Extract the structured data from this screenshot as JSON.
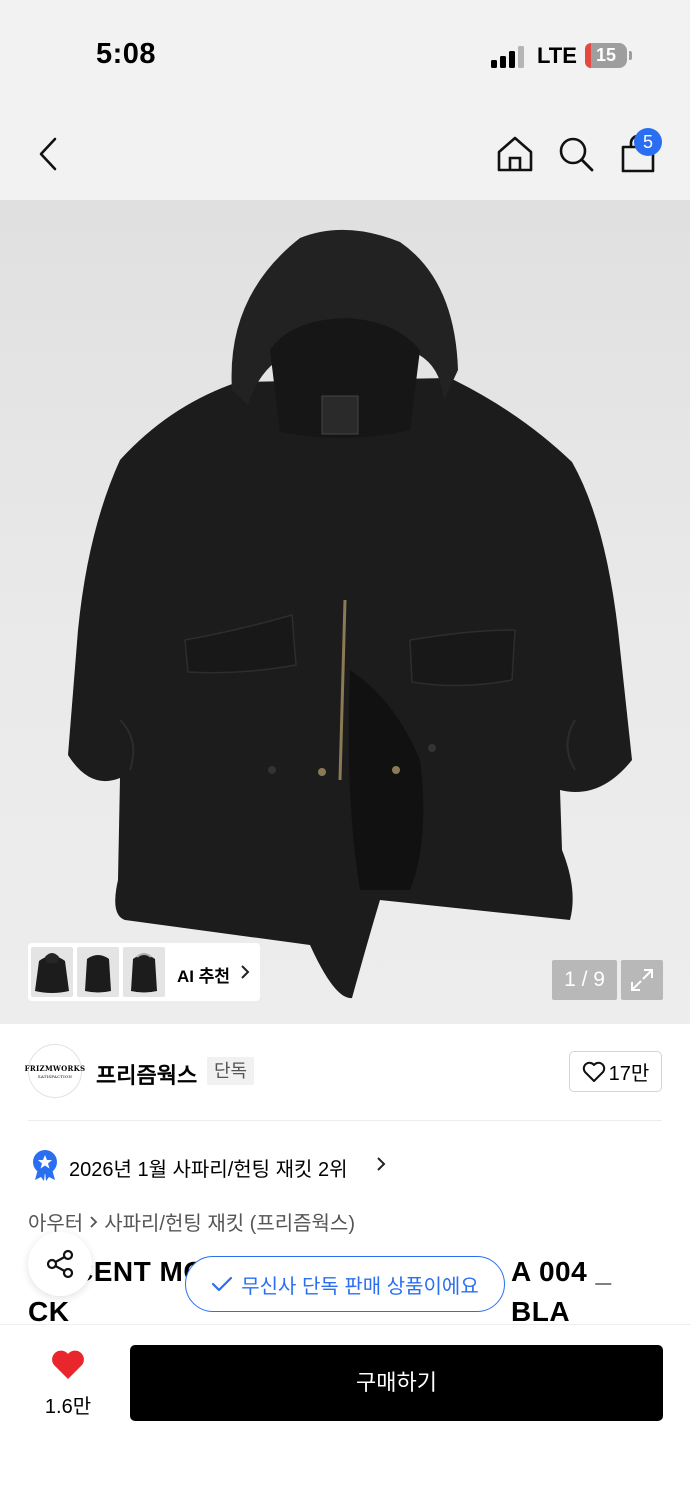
{
  "status_bar": {
    "time": "5:08",
    "network": "LTE",
    "battery": "15",
    "battery_level": 0.15
  },
  "nav": {
    "icons": [
      "back-icon",
      "home-icon",
      "search-icon",
      "cart-icon"
    ],
    "cart_count": "5"
  },
  "gallery": {
    "page_indicator": "1 / 9",
    "ai_recommend_label": "AI 추천",
    "ai_thumbnails": 3
  },
  "brand": {
    "logo_line1": "FRIZMWORKS",
    "logo_line2": "SATISFACTION",
    "name": "프리즘웍스",
    "tag": "단독",
    "like_count": "17만"
  },
  "ranking": {
    "text": "2026년 1월 사파리/헌팅 재킷 2위"
  },
  "breadcrumb": {
    "category": "아우터",
    "subcategory": "사파리/헌팅 재킷 (프리즘웍스)"
  },
  "product": {
    "title_line1": "CENT MO",
    "title_line1_end": "A 004 _ BLA",
    "title_line2": "CK"
  },
  "toast": {
    "text": "무신사 단독 판매 상품이에요"
  },
  "bottom_bar": {
    "wish_count": "1.6만",
    "buy_label": "구매하기"
  },
  "colors": {
    "accent_blue": "#2a6ff2",
    "heart_red": "#e8262b",
    "buy_button": "#000000",
    "battery_red": "#e5483f"
  }
}
